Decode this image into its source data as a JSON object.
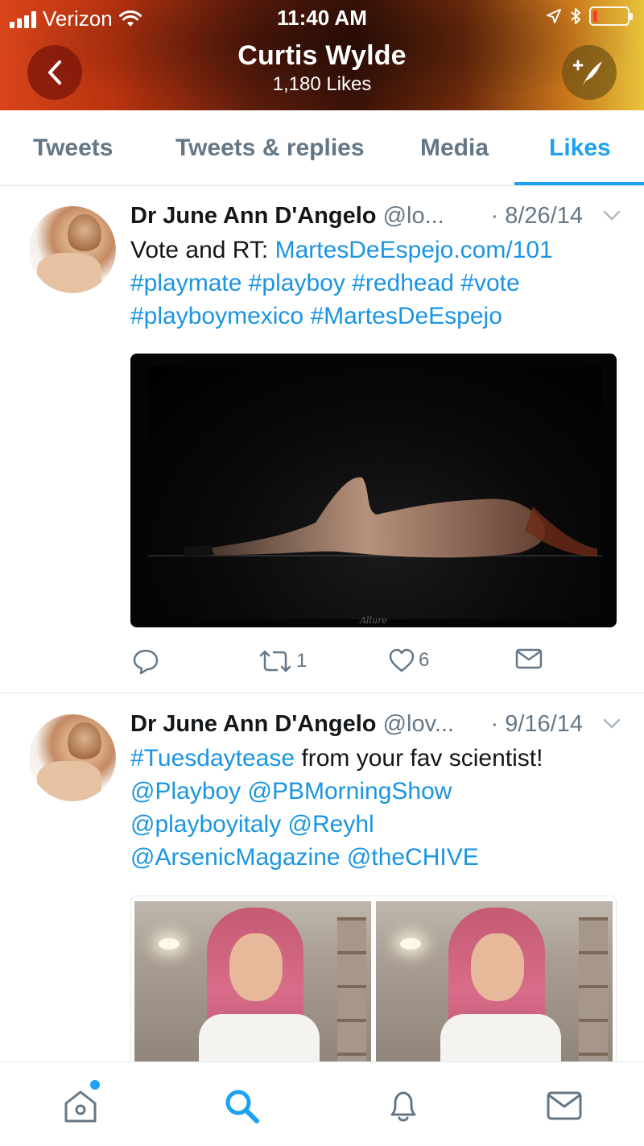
{
  "status_bar": {
    "carrier": "Verizon",
    "time": "11:40 AM"
  },
  "header": {
    "title": "Curtis Wylde",
    "subtitle": "1,180 Likes",
    "back_icon": "chevron-left-icon",
    "compose_icon": "compose-tweet-icon"
  },
  "tabs": [
    {
      "label": "Tweets",
      "active": false
    },
    {
      "label": "Tweets & replies",
      "active": false
    },
    {
      "label": "Media",
      "active": false
    },
    {
      "label": "Likes",
      "active": true
    }
  ],
  "colors": {
    "accent": "#1da1f2",
    "link": "#1b95e0",
    "muted": "#657786"
  },
  "tweets": [
    {
      "name": "Dr June Ann D'Angelo",
      "handle": "@lo...",
      "date": "· 8/26/14",
      "text": {
        "line1_prefix": "Vote and RT: ",
        "line1_link": "MartesDeEspejo.com/101",
        "line2": "#playmate #playboy #redhead #vote",
        "line3": "#playboymexico #MartesDeEspejo"
      },
      "media_caption": "Allure",
      "retweets": "1",
      "likes": "6"
    },
    {
      "name": "Dr June Ann D'Angelo",
      "handle": "@lov...",
      "date": "· 9/16/14",
      "text": {
        "line1_link": "#Tuesdaytease",
        "line1_suffix": " from your fav scientist!",
        "line2": "@Playboy @PBMorningShow",
        "line3": "@playboyitaly @Reyhl",
        "line4": "@ArsenicMagazine @theCHIVE"
      }
    }
  ],
  "bottom_nav": [
    {
      "icon": "home-icon",
      "active": false,
      "has_notification_dot": true
    },
    {
      "icon": "search-icon",
      "active": true
    },
    {
      "icon": "notifications-bell-icon",
      "active": false
    },
    {
      "icon": "messages-envelope-icon",
      "active": false
    }
  ]
}
